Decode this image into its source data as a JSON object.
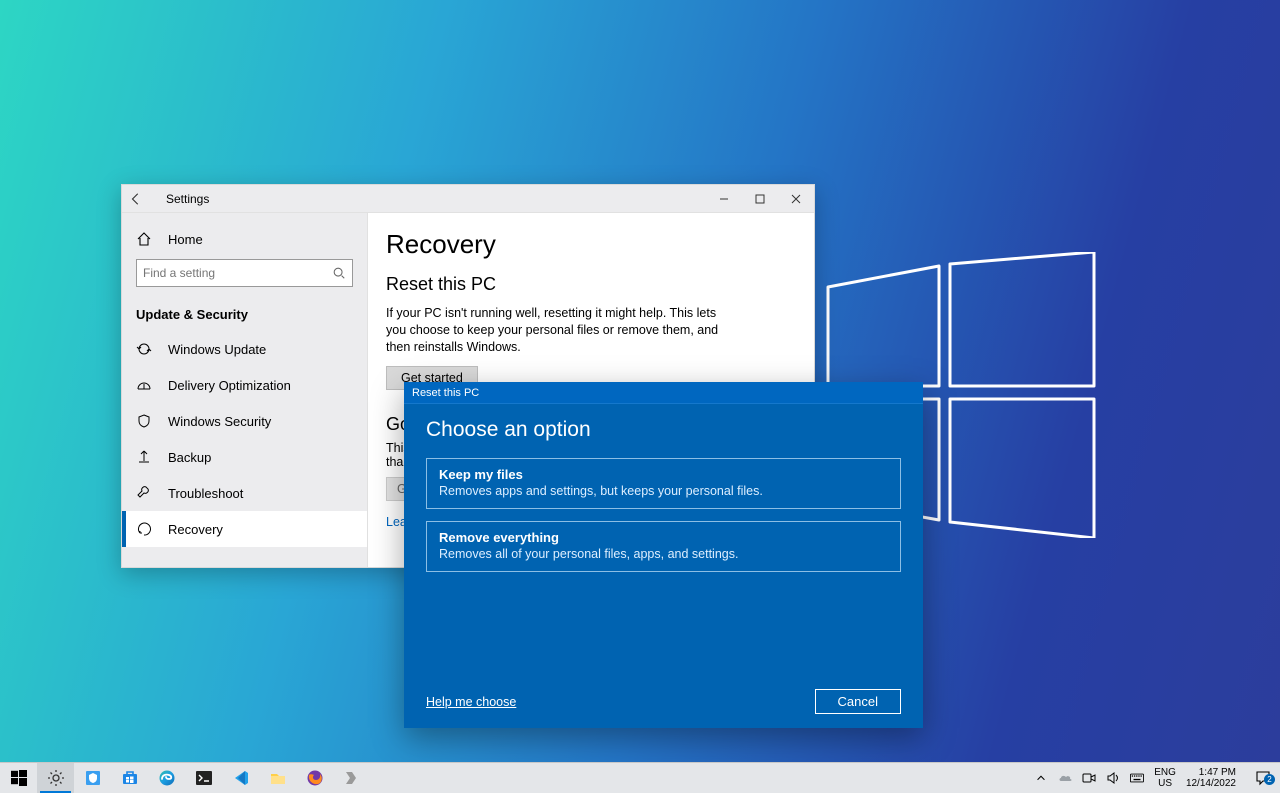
{
  "settings": {
    "window_title": "Settings",
    "home_label": "Home",
    "search_placeholder": "Find a setting",
    "section_header": "Update & Security",
    "nav_items": [
      {
        "label": "Windows Update"
      },
      {
        "label": "Delivery Optimization"
      },
      {
        "label": "Windows Security"
      },
      {
        "label": "Backup"
      },
      {
        "label": "Troubleshoot"
      },
      {
        "label": "Recovery"
      }
    ],
    "main": {
      "heading": "Recovery",
      "subheading": "Reset this PC",
      "description": "If your PC isn't running well, resetting it might help. This lets you choose to keep your personal files or remove them, and then reinstalls Windows.",
      "get_started": "Get started",
      "partial_heading": "Go",
      "partial_text": "This\nthan",
      "partial_button": "G",
      "learn_link": "Lear"
    }
  },
  "reset": {
    "title": "Reset this PC",
    "heading": "Choose an option",
    "options": [
      {
        "title": "Keep my files",
        "desc": "Removes apps and settings, but keeps your personal files."
      },
      {
        "title": "Remove everything",
        "desc": "Removes all of your personal files, apps, and settings."
      }
    ],
    "help_link": "Help me choose",
    "cancel": "Cancel"
  },
  "taskbar": {
    "lang_top": "ENG",
    "lang_bottom": "US",
    "time": "1:47 PM",
    "date": "12/14/2022",
    "action_center_count": "2"
  }
}
